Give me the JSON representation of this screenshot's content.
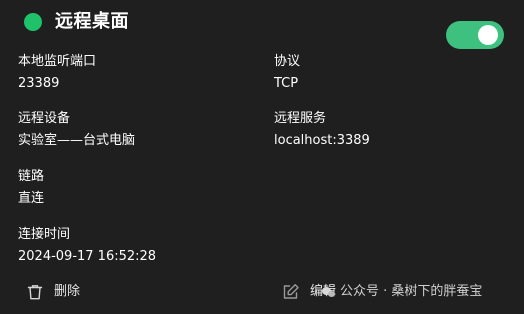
{
  "card": {
    "title": "远程桌面",
    "status_color": "#1fc16b",
    "toggle_color": "#3ec07f",
    "enabled": true
  },
  "fields": {
    "local_port": {
      "label": "本地监听端口",
      "value": "23389"
    },
    "protocol": {
      "label": "协议",
      "value": "TCP"
    },
    "remote_device": {
      "label": "远程设备",
      "value": "实验室——台式电脑"
    },
    "remote_service": {
      "label": "远程服务",
      "value": "localhost:3389"
    },
    "link": {
      "label": "链路",
      "value": "直连"
    },
    "connect_time": {
      "label": "连接时间",
      "value": "2024-09-17 16:52:28"
    }
  },
  "actions": {
    "delete_label": "删除",
    "delete_icon": "trash-icon",
    "edit_label": "编辑",
    "edit_icon": "edit-icon"
  },
  "watermark": {
    "text": "公众号 · 桑树下的胖蚕宝"
  }
}
